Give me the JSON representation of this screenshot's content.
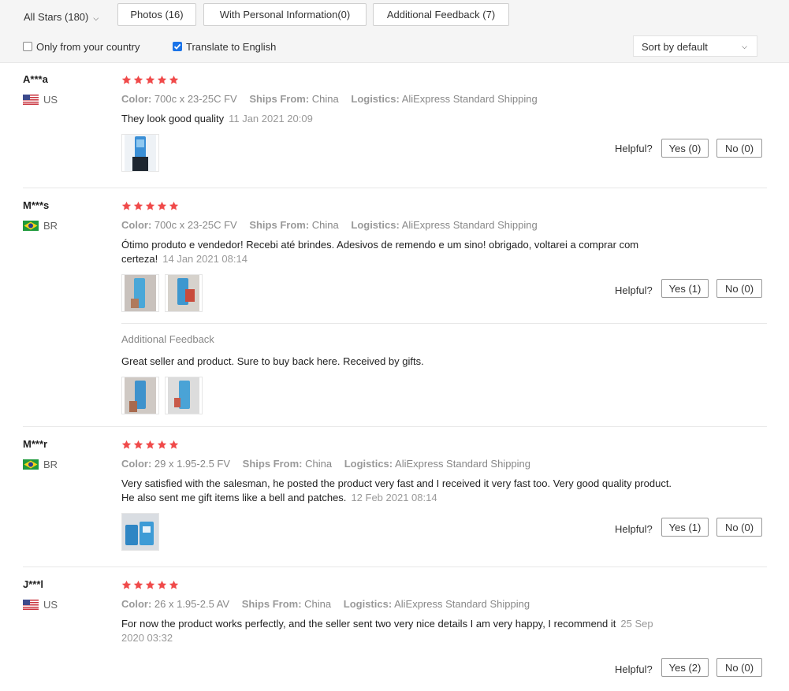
{
  "filters": {
    "all_stars": "All Stars (180)",
    "photos": "Photos (16)",
    "personal": "With Personal Information(0)",
    "additional": "Additional Feedback (7)",
    "only_country": "Only from your country",
    "only_country_checked": false,
    "translate": "Translate to English",
    "translate_checked": true,
    "sort": "Sort by default"
  },
  "labels": {
    "color": "Color:",
    "ships_from": "Ships From:",
    "logistics": "Logistics:",
    "helpful": "Helpful?",
    "additional_feedback": "Additional Feedback"
  },
  "colors": {
    "star": "#f04a4a",
    "accent_check": "#1a73e8"
  },
  "reviews": [
    {
      "user": "A***a",
      "country": "US",
      "rating": 5,
      "color": "700c x 23-25C FV",
      "ships_from": "China",
      "logistics": "AliExpress Standard Shipping",
      "text": "They look good quality",
      "date": "11 Jan 2021 20:09",
      "photos": 1,
      "yes": "Yes (0)",
      "no": "No (0)"
    },
    {
      "user": "M***s",
      "country": "BR",
      "rating": 5,
      "color": "700c x 23-25C FV",
      "ships_from": "China",
      "logistics": "AliExpress Standard Shipping",
      "text": "Ótimo produto e vendedor! Recebi até brindes. Adesivos de remendo e um sino! obrigado, voltarei a comprar com certeza!",
      "date": "14 Jan 2021 08:14",
      "photos": 2,
      "yes": "Yes (1)",
      "no": "No (0)",
      "additional_text": "Great seller and product. Sure to buy back here. Received by gifts.",
      "additional_photos": 2
    },
    {
      "user": "M***r",
      "country": "BR",
      "rating": 5,
      "color": "29 x 1.95-2.5 FV",
      "ships_from": "China",
      "logistics": "AliExpress Standard Shipping",
      "text": "Very satisfied with the salesman, he posted the product very fast and I received it very fast too. Very good quality product. He also sent me gift items like a bell and patches.",
      "date": "12 Feb 2021 08:14",
      "photos": 1,
      "yes": "Yes (1)",
      "no": "No (0)"
    },
    {
      "user": "J***l",
      "country": "US",
      "rating": 5,
      "color": "26 x 1.95-2.5 AV",
      "ships_from": "China",
      "logistics": "AliExpress Standard Shipping",
      "text": "For now the product works perfectly, and the seller sent two very nice details I am very happy, I recommend it",
      "date": "25 Sep 2020 03:32",
      "photos": 0,
      "yes": "Yes (2)",
      "no": "No (0)"
    }
  ]
}
